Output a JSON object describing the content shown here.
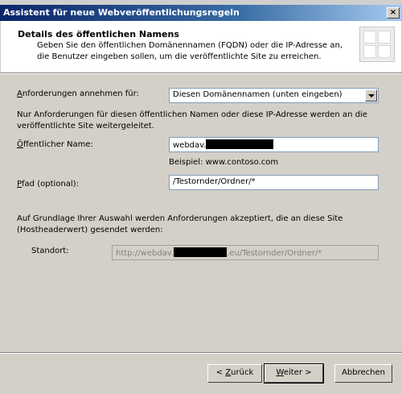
{
  "window": {
    "title": "Assistent für neue Webveröffentlichungsregeln",
    "close_glyph": "×"
  },
  "header": {
    "title": "Details des öffentlichen Namens",
    "subtitle": "Geben Sie den öffentlichen Domänennamen (FQDN) oder die IP-Adresse an, die Benutzer eingeben sollen, um die veröffentlichte Site zu erreichen."
  },
  "form": {
    "accept_requests": {
      "label_mnemonic": "A",
      "label_rest": "nforderungen annehmen für:",
      "selected": "Diesen Domänennamen (unten eingeben)"
    },
    "info_text": "Nur Anforderungen für diesen öffentlichen Namen oder diese IP-Adresse werden an die veröffentlichte Site weitergeleitet.",
    "public_name": {
      "label_mnemonic": "Ö",
      "label_rest": "ffentlicher Name:",
      "value_prefix": "webdav."
    },
    "example": "Beispiel: www.contoso.com",
    "path": {
      "label_mnemonic": "P",
      "label_rest": "fad (optional):",
      "value": "/Testornder/Ordner/*"
    },
    "summary_text": "Auf Grundlage Ihrer Auswahl werden Anforderungen akzeptiert, die an diese Site (Hostheaderwert) gesendet werden:",
    "location": {
      "label": "Standort:",
      "value_prefix": "http://webdav.",
      "value_suffix": ".eu/Testornder/Ordner/*"
    }
  },
  "buttons": {
    "back_prefix": "< ",
    "back_mnemonic": "Z",
    "back_rest": "urück",
    "next_mnemonic": "W",
    "next_rest": "eiter >",
    "cancel": "Abbrechen"
  }
}
